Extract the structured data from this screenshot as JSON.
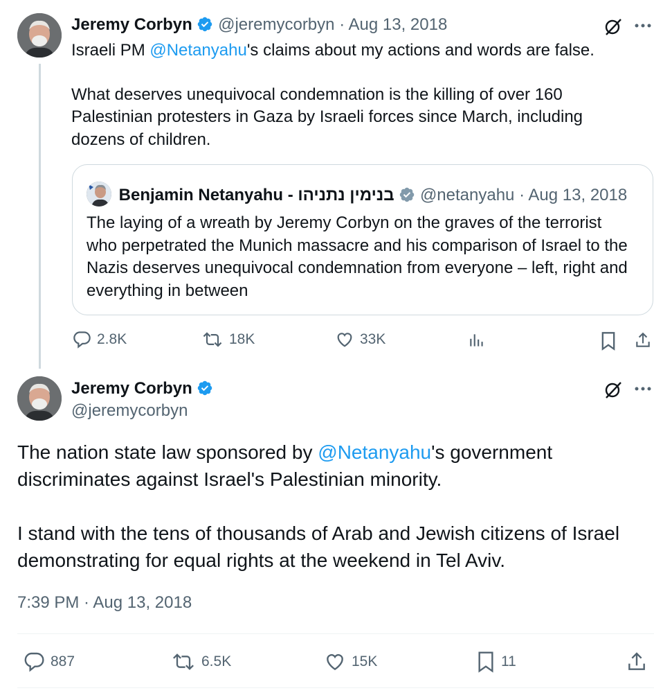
{
  "tweet1": {
    "name": "Jeremy Corbyn",
    "handle": "@jeremycorbyn",
    "sep": "·",
    "date": "Aug 13, 2018",
    "text_pre": "Israeli PM ",
    "mention": "@Netanyahu",
    "text_post": "'s claims about my actions and words are false.",
    "paragraph2": "What deserves unequivocal condemnation is the killing of over 160 Palestinian protesters in Gaza by Israeli forces since March, including dozens of children.",
    "quote": {
      "name": "Benjamin Netanyahu - בנימין נתניהו",
      "handle": "@netanyahu",
      "sep": "·",
      "date": "Aug 13, 2018",
      "text": "The laying of a wreath by Jeremy Corbyn on the graves of the terrorist who perpetrated the Munich massacre and his comparison of Israel to the Nazis deserves unequivocal condemnation from everyone – left, right and everything in between"
    },
    "actions": {
      "replies": "2.8K",
      "reposts": "18K",
      "likes": "33K"
    }
  },
  "tweet2": {
    "name": "Jeremy Corbyn",
    "handle": "@jeremycorbyn",
    "text_pre": "The nation state law sponsored by ",
    "mention": "@Netanyahu",
    "text_post": "'s government discriminates against Israel's Palestinian minority.",
    "paragraph2": "I stand with the tens of thousands of Arab and Jewish citizens of Israel demonstrating for equal rights at the weekend in Tel Aviv.",
    "timestamp": "7:39 PM · Aug 13, 2018",
    "actions": {
      "replies": "887",
      "reposts": "6.5K",
      "likes": "15K",
      "bookmarks": "11"
    }
  },
  "colors": {
    "text": "#0f1419",
    "muted": "#536471",
    "link": "#1d9bf0",
    "verified": "#1d9bf0",
    "border": "#cfd9de",
    "gold": "#829aab"
  },
  "icons": [
    "verified-badge-icon",
    "grok-icon",
    "more-icon",
    "reply-icon",
    "repost-icon",
    "like-icon",
    "views-icon",
    "bookmark-icon",
    "share-icon"
  ]
}
